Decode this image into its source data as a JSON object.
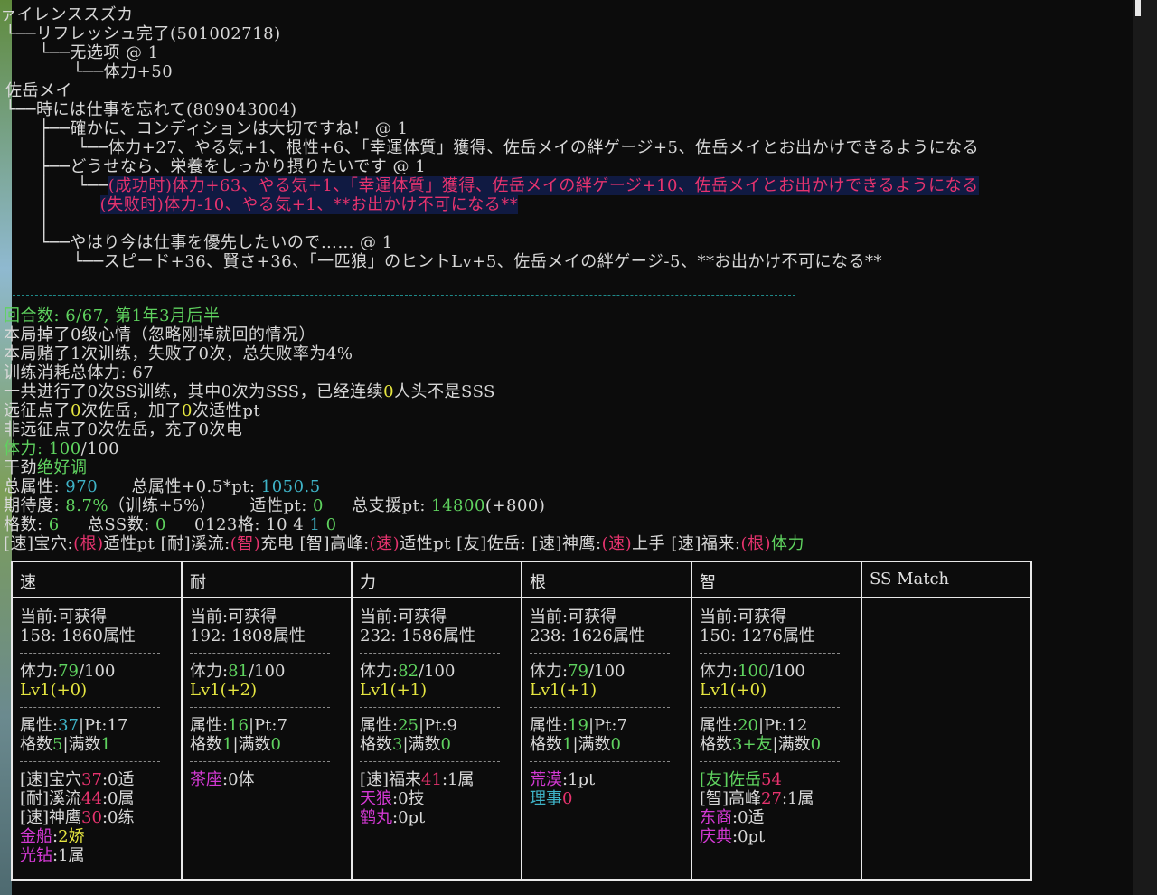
{
  "event_log": [
    {
      "segs": [
        {
          "t": "ァイレンススズカ",
          "c": ""
        }
      ]
    },
    {
      "segs": [
        {
          "t": "└──リフレッシュ完了(501002718)",
          "c": ""
        }
      ]
    },
    {
      "segs": [
        {
          "t": "      └──无选项 @ 1",
          "c": ""
        }
      ]
    },
    {
      "segs": [
        {
          "t": "            └──体力+50",
          "c": ""
        }
      ]
    },
    {
      "segs": [
        {
          "t": "佐岳メイ",
          "c": ""
        }
      ]
    },
    {
      "segs": [
        {
          "t": "└──時には仕事を忘れて(809043004)",
          "c": ""
        }
      ]
    },
    {
      "segs": [
        {
          "t": "      ├──確かに、コンディションは大切ですね！ @ 1",
          "c": ""
        }
      ]
    },
    {
      "segs": [
        {
          "t": "      │     └──体力+27、やる気+1、根性+6、「幸運体質」獲得、佐岳メイの絆ゲージ+5、佐岳メイとお出かけできるようになる",
          "c": ""
        }
      ]
    },
    {
      "segs": [
        {
          "t": "      ├──どうせなら、栄養をしっかり摂りたいです @ 1",
          "c": ""
        }
      ]
    },
    {
      "segs": [
        {
          "t": "      │     └──",
          "c": ""
        },
        {
          "t": "(成功时)体力+63、やる気+1、「幸運体質」獲得、佐岳メイの絆ゲージ+10、佐岳メイとお出かけできるようになる",
          "c": "red hl"
        }
      ]
    },
    {
      "segs": [
        {
          "t": "      │         ",
          "c": ""
        },
        {
          "t": "(失败时)体力-10、やる気+1、**お出かけ不可になる**",
          "c": "red hl"
        }
      ]
    },
    {
      "segs": [
        {
          "t": "      │",
          "c": ""
        }
      ]
    },
    {
      "segs": [
        {
          "t": "      └──やはり今は仕事を優先したいので…… @ 1",
          "c": ""
        }
      ]
    },
    {
      "segs": [
        {
          "t": "            └──スピード+36、賢さ+36、「一匹狼」のヒントLv+5、佐岳メイの絆ゲージ-5、**お出かけ不可になる**",
          "c": ""
        }
      ]
    }
  ],
  "status": [
    {
      "segs": [
        {
          "t": "回合数: 6/67, 第1年3月后半",
          "c": "grn"
        }
      ]
    },
    {
      "segs": [
        {
          "t": "本局掉了0级心情（忽略刚掉就回的情况）",
          "c": ""
        }
      ]
    },
    {
      "segs": [
        {
          "t": "本局赌了1次训练，失败了0次，总失败率为4%",
          "c": ""
        }
      ]
    },
    {
      "segs": [
        {
          "t": "训练消耗总体力: 67",
          "c": ""
        }
      ]
    },
    {
      "segs": [
        {
          "t": "一共进行了0次SS训练，其中0次为SSS，已经连续",
          "c": ""
        },
        {
          "t": "0",
          "c": "yel"
        },
        {
          "t": "人头不是SSS",
          "c": ""
        }
      ]
    },
    {
      "segs": [
        {
          "t": "远征点了",
          "c": ""
        },
        {
          "t": "0",
          "c": "yel"
        },
        {
          "t": "次佐岳，加了",
          "c": ""
        },
        {
          "t": "0",
          "c": "yel"
        },
        {
          "t": "次适性pt",
          "c": ""
        }
      ]
    },
    {
      "segs": [
        {
          "t": "非远征点了0次佐岳，充了0次电",
          "c": ""
        }
      ]
    },
    {
      "segs": [
        {
          "t": "体力: ",
          "c": "grn"
        },
        {
          "t": "100",
          "c": "grn"
        },
        {
          "t": "/100",
          "c": ""
        }
      ]
    },
    {
      "segs": [
        {
          "t": "干劲",
          "c": ""
        },
        {
          "t": "绝好调",
          "c": "grn"
        }
      ]
    },
    {
      "segs": [
        {
          "t": "总属性: ",
          "c": ""
        },
        {
          "t": "970",
          "c": "cyan"
        },
        {
          "t": "      总属性+0.5*pt: ",
          "c": ""
        },
        {
          "t": "1050.5",
          "c": "cyan"
        }
      ]
    },
    {
      "segs": [
        {
          "t": "期待度: ",
          "c": ""
        },
        {
          "t": "8.7%",
          "c": "grn"
        },
        {
          "t": "（训练+5%）      适性pt: ",
          "c": ""
        },
        {
          "t": "0",
          "c": "grn"
        },
        {
          "t": "     总支援pt: ",
          "c": ""
        },
        {
          "t": "14800",
          "c": "grn"
        },
        {
          "t": "(+800)",
          "c": ""
        }
      ]
    },
    {
      "segs": [
        {
          "t": "格数: ",
          "c": ""
        },
        {
          "t": "6",
          "c": "grn"
        },
        {
          "t": "     总SS数: ",
          "c": ""
        },
        {
          "t": "0",
          "c": "grn"
        },
        {
          "t": "     0123格: 10 4 ",
          "c": ""
        },
        {
          "t": "1",
          "c": "cyan"
        },
        {
          "t": " ",
          "c": ""
        },
        {
          "t": "0",
          "c": "grn"
        }
      ]
    },
    {
      "segs": [
        {
          "t": "[速]宝穴:",
          "c": ""
        },
        {
          "t": "(根)",
          "c": "red"
        },
        {
          "t": "适性pt [耐]溪流:",
          "c": ""
        },
        {
          "t": "(智)",
          "c": "red"
        },
        {
          "t": "充电 [智]高峰:",
          "c": ""
        },
        {
          "t": "(速)",
          "c": "red"
        },
        {
          "t": "适性pt [友]佐岳: [速]神鹰:",
          "c": ""
        },
        {
          "t": "(速)",
          "c": "red"
        },
        {
          "t": "上手 [速]福来:",
          "c": ""
        },
        {
          "t": "(根)",
          "c": "red"
        },
        {
          "t": "体力",
          "c": "grn"
        }
      ]
    }
  ],
  "table": {
    "headers": [
      "速",
      "耐",
      "力",
      "根",
      "智",
      "SS Match"
    ],
    "columns": [
      {
        "gain": [
          [
            {
              "t": "当前:可获得",
              "c": ""
            }
          ],
          [
            {
              "t": "158: 1860属性",
              "c": ""
            }
          ]
        ],
        "stamina": [
          [
            {
              "t": "体力:",
              "c": ""
            },
            {
              "t": "79",
              "c": "grn"
            },
            {
              "t": "/100",
              "c": ""
            }
          ],
          [
            {
              "t": "Lv1(+0)",
              "c": "yel"
            }
          ]
        ],
        "attr": [
          [
            {
              "t": "属性:",
              "c": ""
            },
            {
              "t": "37",
              "c": "cyan"
            },
            {
              "t": "|Pt:17",
              "c": ""
            }
          ],
          [
            {
              "t": "格数",
              "c": ""
            },
            {
              "t": "5",
              "c": "grn"
            },
            {
              "t": "|满数",
              "c": ""
            },
            {
              "t": "1",
              "c": "grn"
            }
          ]
        ],
        "support": [
          [
            {
              "t": "[速]宝穴",
              "c": ""
            },
            {
              "t": "37",
              "c": "red"
            },
            {
              "t": ":0适",
              "c": ""
            }
          ],
          [
            {
              "t": "[耐]溪流",
              "c": ""
            },
            {
              "t": "44",
              "c": "red"
            },
            {
              "t": ":0属",
              "c": ""
            }
          ],
          [
            {
              "t": "[速]神鹰",
              "c": ""
            },
            {
              "t": "30",
              "c": "red"
            },
            {
              "t": ":0练",
              "c": ""
            }
          ],
          [
            {
              "t": "金船",
              "c": "mag"
            },
            {
              "t": ":",
              "c": ""
            },
            {
              "t": "2娇",
              "c": "yel"
            }
          ],
          [
            {
              "t": "光钻",
              "c": "mag"
            },
            {
              "t": ":1属",
              "c": ""
            }
          ]
        ]
      },
      {
        "gain": [
          [
            {
              "t": "当前:可获得",
              "c": ""
            }
          ],
          [
            {
              "t": "192: 1808属性",
              "c": ""
            }
          ]
        ],
        "stamina": [
          [
            {
              "t": "体力:",
              "c": ""
            },
            {
              "t": "81",
              "c": "grn"
            },
            {
              "t": "/100",
              "c": ""
            }
          ],
          [
            {
              "t": "Lv1(+2)",
              "c": "yel"
            }
          ]
        ],
        "attr": [
          [
            {
              "t": "属性:",
              "c": ""
            },
            {
              "t": "16",
              "c": "grn"
            },
            {
              "t": "|Pt:7",
              "c": ""
            }
          ],
          [
            {
              "t": "格数",
              "c": ""
            },
            {
              "t": "1",
              "c": "grn"
            },
            {
              "t": "|满数",
              "c": ""
            },
            {
              "t": "0",
              "c": "grn"
            }
          ]
        ],
        "support": [
          [
            {
              "t": "茶座",
              "c": "mag"
            },
            {
              "t": ":0体",
              "c": ""
            }
          ]
        ]
      },
      {
        "gain": [
          [
            {
              "t": "当前:可获得",
              "c": ""
            }
          ],
          [
            {
              "t": "232: 1586属性",
              "c": ""
            }
          ]
        ],
        "stamina": [
          [
            {
              "t": "体力:",
              "c": ""
            },
            {
              "t": "82",
              "c": "grn"
            },
            {
              "t": "/100",
              "c": ""
            }
          ],
          [
            {
              "t": "Lv1(+1)",
              "c": "yel"
            }
          ]
        ],
        "attr": [
          [
            {
              "t": "属性:",
              "c": ""
            },
            {
              "t": "25",
              "c": "grn"
            },
            {
              "t": "|Pt:9",
              "c": ""
            }
          ],
          [
            {
              "t": "格数",
              "c": ""
            },
            {
              "t": "3",
              "c": "grn"
            },
            {
              "t": "|满数",
              "c": ""
            },
            {
              "t": "0",
              "c": "grn"
            }
          ]
        ],
        "support": [
          [
            {
              "t": "[速]福来",
              "c": ""
            },
            {
              "t": "41",
              "c": "red"
            },
            {
              "t": ":1属",
              "c": ""
            }
          ],
          [
            {
              "t": "天狼",
              "c": "mag"
            },
            {
              "t": ":0技",
              "c": ""
            }
          ],
          [
            {
              "t": "鹤丸",
              "c": "mag"
            },
            {
              "t": ":0pt",
              "c": ""
            }
          ]
        ]
      },
      {
        "gain": [
          [
            {
              "t": "当前:可获得",
              "c": ""
            }
          ],
          [
            {
              "t": "238: 1626属性",
              "c": ""
            }
          ]
        ],
        "stamina": [
          [
            {
              "t": "体力:",
              "c": ""
            },
            {
              "t": "79",
              "c": "grn"
            },
            {
              "t": "/100",
              "c": ""
            }
          ],
          [
            {
              "t": "Lv1(+1)",
              "c": "yel"
            }
          ]
        ],
        "attr": [
          [
            {
              "t": "属性:",
              "c": ""
            },
            {
              "t": "19",
              "c": "grn"
            },
            {
              "t": "|Pt:7",
              "c": ""
            }
          ],
          [
            {
              "t": "格数",
              "c": ""
            },
            {
              "t": "1",
              "c": "grn"
            },
            {
              "t": "|满数",
              "c": ""
            },
            {
              "t": "0",
              "c": "grn"
            }
          ]
        ],
        "support": [
          [
            {
              "t": "荒漠",
              "c": "mag"
            },
            {
              "t": ":1pt",
              "c": ""
            }
          ],
          [
            {
              "t": "理事",
              "c": "cyan"
            },
            {
              "t": "0",
              "c": "red"
            }
          ]
        ]
      },
      {
        "gain": [
          [
            {
              "t": "当前:可获得",
              "c": ""
            }
          ],
          [
            {
              "t": "150: 1276属性",
              "c": ""
            }
          ]
        ],
        "stamina": [
          [
            {
              "t": "体力:",
              "c": ""
            },
            {
              "t": "100",
              "c": "grn"
            },
            {
              "t": "/100",
              "c": ""
            }
          ],
          [
            {
              "t": "Lv1(+0)",
              "c": "yel"
            }
          ]
        ],
        "attr": [
          [
            {
              "t": "属性:",
              "c": ""
            },
            {
              "t": "20",
              "c": "grn"
            },
            {
              "t": "|Pt:12",
              "c": ""
            }
          ],
          [
            {
              "t": "格数",
              "c": ""
            },
            {
              "t": "3+友",
              "c": "grn"
            },
            {
              "t": "|满数",
              "c": ""
            },
            {
              "t": "0",
              "c": "grn"
            }
          ]
        ],
        "support": [
          [
            {
              "t": "[友]佐岳",
              "c": "grn"
            },
            {
              "t": "54",
              "c": "red"
            }
          ],
          [
            {
              "t": "[智]高峰",
              "c": ""
            },
            {
              "t": "27",
              "c": "red"
            },
            {
              "t": ":1属",
              "c": ""
            }
          ],
          [
            {
              "t": "东商",
              "c": "mag"
            },
            {
              "t": ":0适",
              "c": ""
            }
          ],
          [
            {
              "t": "庆典",
              "c": "mag"
            },
            {
              "t": ":0pt",
              "c": ""
            }
          ]
        ]
      },
      {
        "gain": [],
        "stamina": [],
        "attr": [],
        "support": []
      }
    ]
  }
}
